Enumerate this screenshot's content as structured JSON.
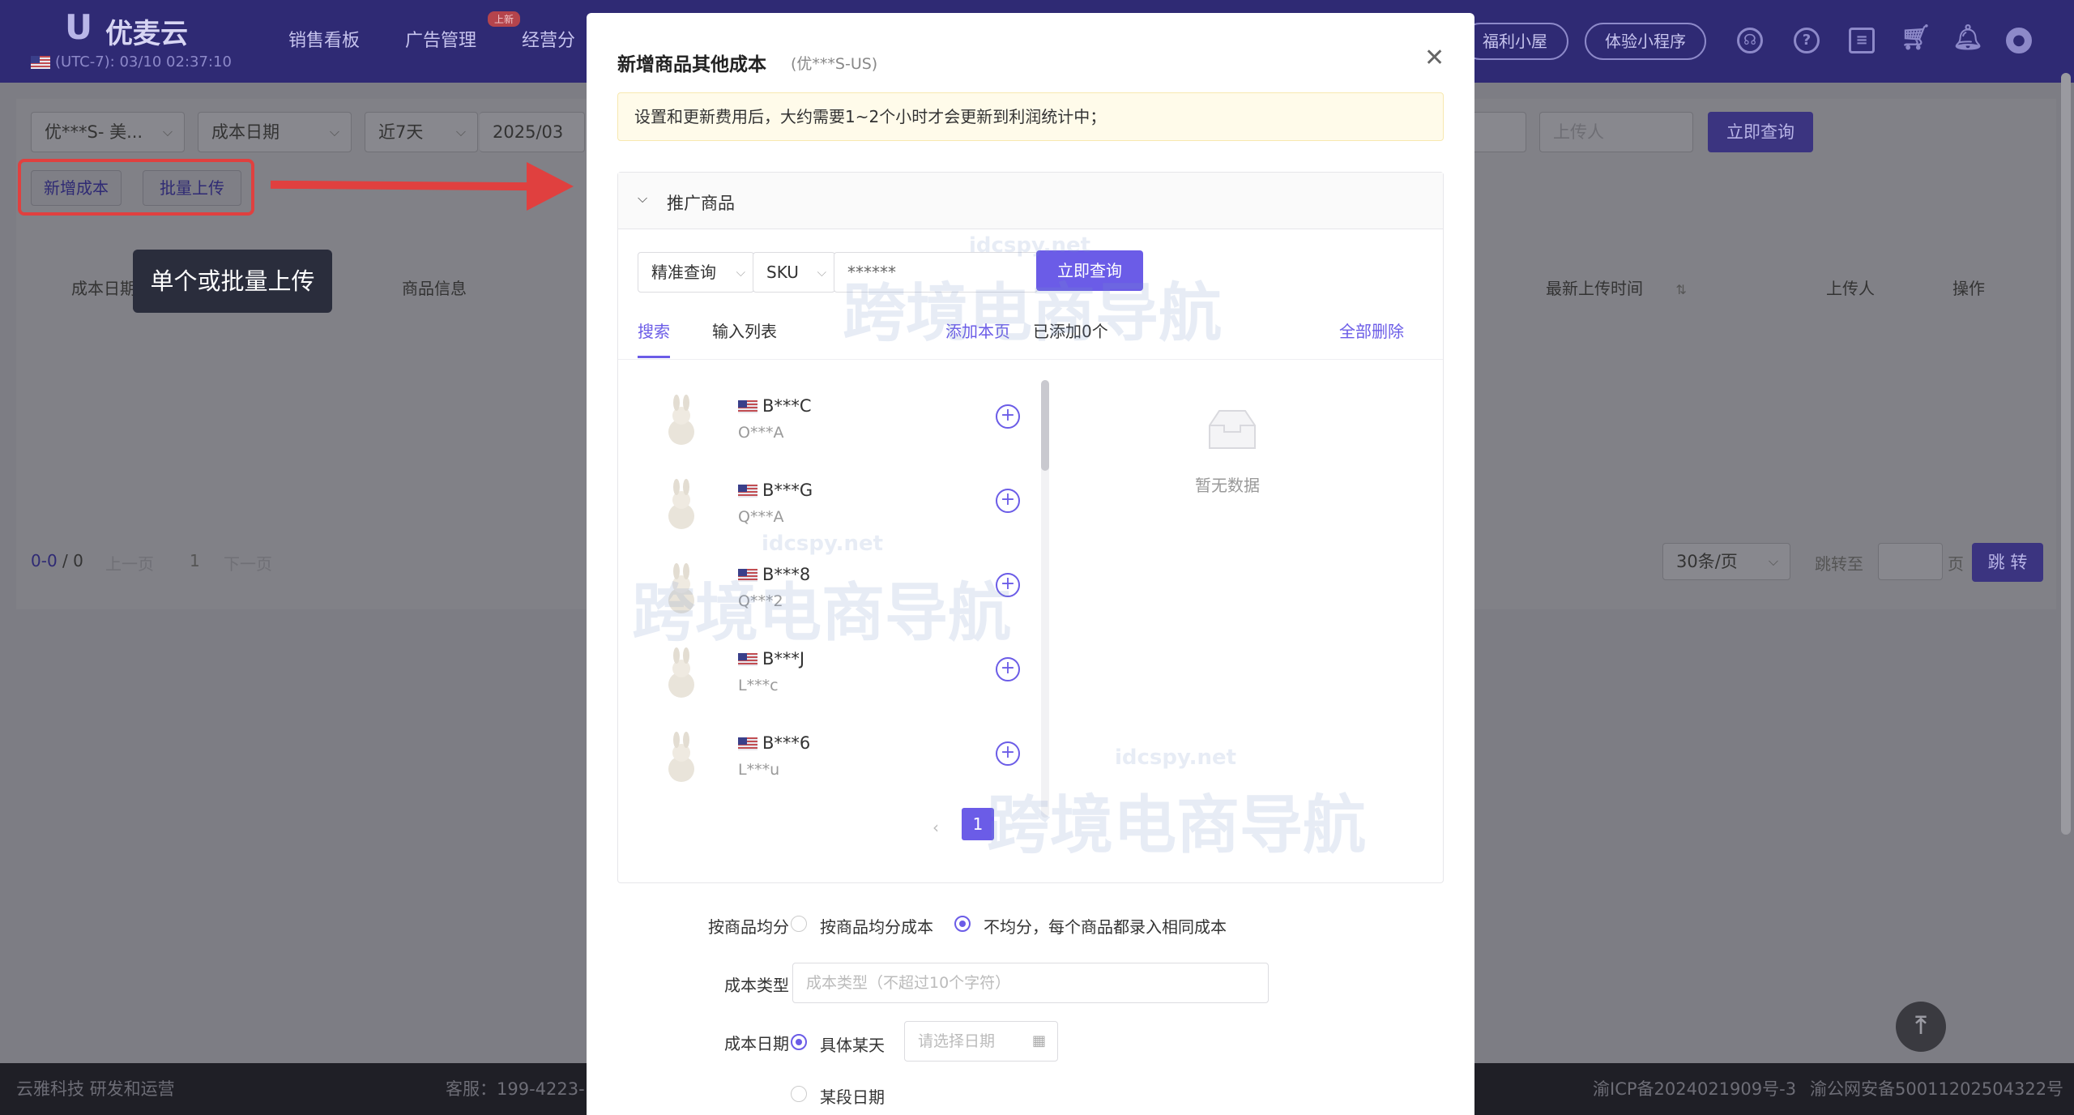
{
  "app": {
    "logo": "优麦云",
    "timezone": "(UTC-7): 03/10 02:37:10",
    "nav": [
      "销售看板",
      "广告管理",
      "经营分"
    ],
    "nav_badge": "上新",
    "pills": [
      "福利小屋",
      "体验小程序"
    ]
  },
  "filters": {
    "shop": "优***S- 美...",
    "date_type": "成本日期",
    "range": "近7天",
    "date_start": "2025/03",
    "uploader_placeholder": "上传人",
    "query_button": "立即查询"
  },
  "actions": {
    "add_cost": "新增成本",
    "batch_upload": "批量上传"
  },
  "tooltip": "单个或批量上传",
  "table": {
    "headers": [
      "成本日期",
      "商品信息",
      "最新上传时间",
      "上传人",
      "操作"
    ]
  },
  "pager": {
    "summary_a": "0-0",
    "summary_b": "/ 0",
    "prev": "上一页",
    "page": "1",
    "next": "下一页",
    "per_page": "30条/页",
    "jump_label": "跳转至",
    "page_unit": "页",
    "jump_button": "跳 转"
  },
  "footer": {
    "left": "云雅科技 研发和运营",
    "service": "客服：199-4223-",
    "icp": "渝ICP备2024021909号-3",
    "police": "渝公网安备50011202504322号"
  },
  "modal": {
    "title": "新增商品其他成本",
    "subtitle": "(优***S-US)",
    "notice": "设置和更新费用后，大约需要1~2个小时才会更新到利润统计中；",
    "panel_title": "推广商品",
    "search_mode": "精准查询",
    "search_field": "SKU",
    "search_value": "******",
    "query_button": "立即查询",
    "tabs": [
      "搜索",
      "输入列表"
    ],
    "add_page": "添加本页",
    "added_count": "已添加0个",
    "delete_all": "全部删除",
    "products": [
      {
        "sku": "B***C",
        "asin": "O***A"
      },
      {
        "sku": "B***G",
        "asin": "Q***A"
      },
      {
        "sku": "B***8",
        "asin": "Q***2"
      },
      {
        "sku": "B***J",
        "asin": "L***c"
      },
      {
        "sku": "B***6",
        "asin": "L***u"
      }
    ],
    "empty_text": "暂无数据",
    "current_page": "1",
    "split_label": "按商品均分",
    "split_option_a": "按商品均分成本",
    "split_option_b": "不均分，每个商品都录入相同成本",
    "cost_type_label": "成本类型",
    "cost_type_placeholder": "成本类型（不超过10个字符）",
    "cost_date_label": "成本日期",
    "date_option_a": "具体某天",
    "date_option_b": "某段日期",
    "date_placeholder": "请选择日期"
  },
  "watermark": {
    "domain": "idcspy.net",
    "text": "跨境电商导航"
  },
  "colors": {
    "accent": "#6b5ce7",
    "topbar": "#2f2a74",
    "highlight": "#e0403f"
  }
}
